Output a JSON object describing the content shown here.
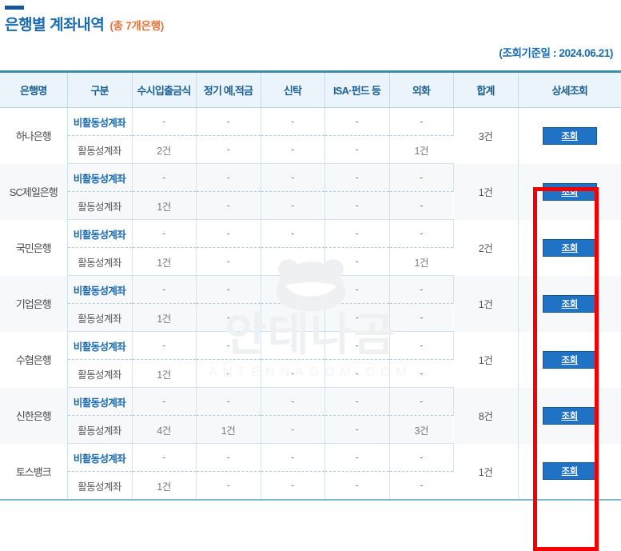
{
  "header": {
    "title": "은행별 계좌내역",
    "count_label": "(총 7개은행)",
    "asof_label": "(조회기준일 : 2024.06.21)",
    "accent_color": "#16559a",
    "title_color": "#1a6bb0",
    "count_color": "#e8743b"
  },
  "watermark": {
    "text": "안테나곰",
    "domain": "ANTENNAGOM.COM"
  },
  "table": {
    "columns": [
      "은행명",
      "구분",
      "수시입출금식",
      "정기 예,적금",
      "신탁",
      "ISA·펀드 등",
      "외화",
      "합계",
      "상세조회"
    ],
    "type_inactive_label": "비활동성계좌",
    "type_active_label": "활동성계좌",
    "detail_button_label": "조회",
    "empty_value": "-",
    "rows": [
      {
        "bank": "하나은행",
        "total": "3건",
        "inactive": {
          "demand": "-",
          "savings": "-",
          "trust": "-",
          "isa": "-",
          "forex": "-"
        },
        "active": {
          "demand": "2건",
          "savings": "-",
          "trust": "-",
          "isa": "-",
          "forex": "1건"
        }
      },
      {
        "bank": "SC제일은행",
        "total": "1건",
        "inactive": {
          "demand": "-",
          "savings": "-",
          "trust": "-",
          "isa": "-",
          "forex": "-"
        },
        "active": {
          "demand": "1건",
          "savings": "-",
          "trust": "-",
          "isa": "-",
          "forex": "-"
        }
      },
      {
        "bank": "국민은행",
        "total": "2건",
        "inactive": {
          "demand": "-",
          "savings": "-",
          "trust": "-",
          "isa": "-",
          "forex": "-"
        },
        "active": {
          "demand": "1건",
          "savings": "-",
          "trust": "-",
          "isa": "-",
          "forex": "1건"
        }
      },
      {
        "bank": "기업은행",
        "total": "1건",
        "inactive": {
          "demand": "-",
          "savings": "-",
          "trust": "-",
          "isa": "-",
          "forex": "-"
        },
        "active": {
          "demand": "1건",
          "savings": "-",
          "trust": "-",
          "isa": "-",
          "forex": "-"
        }
      },
      {
        "bank": "수협은행",
        "total": "1건",
        "inactive": {
          "demand": "-",
          "savings": "-",
          "trust": "-",
          "isa": "-",
          "forex": "-"
        },
        "active": {
          "demand": "1건",
          "savings": "-",
          "trust": "-",
          "isa": "-",
          "forex": "-"
        }
      },
      {
        "bank": "신한은행",
        "total": "8건",
        "inactive": {
          "demand": "-",
          "savings": "-",
          "trust": "-",
          "isa": "-",
          "forex": "-"
        },
        "active": {
          "demand": "4건",
          "savings": "1건",
          "trust": "-",
          "isa": "-",
          "forex": "3건"
        }
      },
      {
        "bank": "토스뱅크",
        "total": "1건",
        "inactive": {
          "demand": "-",
          "savings": "-",
          "trust": "-",
          "isa": "-",
          "forex": "-"
        },
        "active": {
          "demand": "1건",
          "savings": "-",
          "trust": "-",
          "isa": "-",
          "forex": "-"
        }
      }
    ]
  },
  "annotation": {
    "highlight_color": "#f50000"
  }
}
